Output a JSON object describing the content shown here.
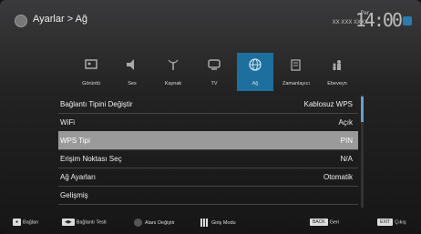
{
  "header": {
    "breadcrumb": "Ayarlar > Ağ",
    "day": "Per",
    "date": "XX XXX XXXX",
    "time": "14:00"
  },
  "icons": [
    {
      "label": "Görüntü",
      "icon": "picture-icon",
      "active": false
    },
    {
      "label": "Ses",
      "icon": "speaker-icon",
      "active": false
    },
    {
      "label": "Kaynak",
      "icon": "antenna-icon",
      "active": false
    },
    {
      "label": "TV",
      "icon": "tv-icon",
      "active": false
    },
    {
      "label": "Ağ",
      "icon": "network-icon",
      "active": true
    },
    {
      "label": "Zamanlayıcı",
      "icon": "timer-icon",
      "active": false
    },
    {
      "label": "Ebeveyn",
      "icon": "parental-icon",
      "active": false
    }
  ],
  "menu": [
    {
      "label": "Bağlantı Tipini Değiştir",
      "value": "Kablosuz WPS",
      "selected": false
    },
    {
      "label": "WiFi",
      "value": "Açık",
      "selected": false
    },
    {
      "label": "WPS Tipi",
      "value": "PIN",
      "selected": true
    },
    {
      "label": "Erişim Noktası Seç",
      "value": "N/A",
      "selected": false
    },
    {
      "label": "Ağ Ayarları",
      "value": "Otomatik",
      "selected": false
    },
    {
      "label": "Gelişmiş",
      "value": "",
      "selected": false
    }
  ],
  "footer": {
    "connect": "Bağlan",
    "connection_test": "Bağlantı Testi",
    "change_field": "Alanı Değiştir",
    "login_mode": "Giriş Modu",
    "back_key": "BACK",
    "back": "Geri",
    "exit_key": "EXIT",
    "exit": "Çıkış"
  },
  "colors": {
    "accent": "#1d6f9e",
    "selected_row": "#9a9a9a",
    "background": "#222222"
  }
}
